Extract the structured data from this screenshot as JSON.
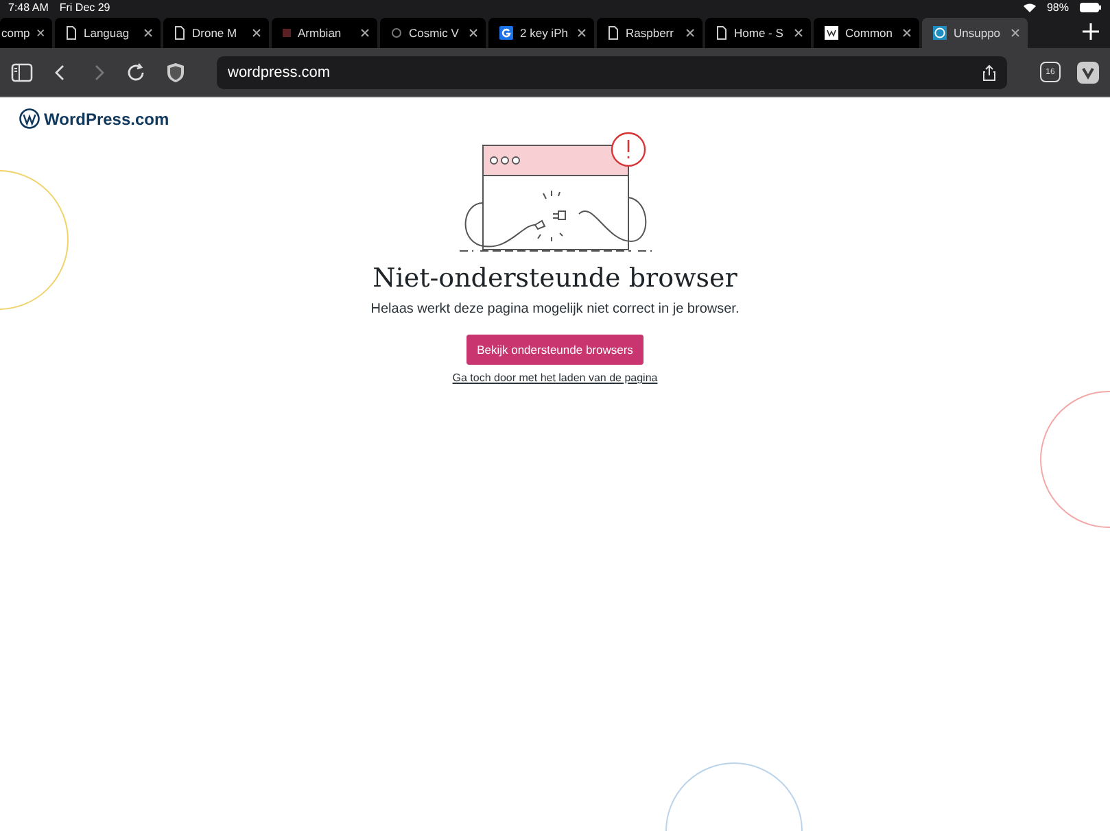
{
  "status_bar": {
    "time": "7:48 AM",
    "date": "Fri Dec 29",
    "battery": "98%"
  },
  "tabs": [
    {
      "label": "comp",
      "kind": "plain",
      "selected": false
    },
    {
      "label": "Languag",
      "kind": "doc",
      "selected": false
    },
    {
      "label": "Drone M",
      "kind": "doc",
      "selected": false
    },
    {
      "label": "Armbian",
      "kind": "square",
      "selected": false
    },
    {
      "label": "Cosmic V",
      "kind": "dot",
      "selected": false
    },
    {
      "label": "2 key iPh",
      "kind": "g",
      "selected": false
    },
    {
      "label": "Raspberr",
      "kind": "doc",
      "selected": false
    },
    {
      "label": "Home - S",
      "kind": "doc",
      "selected": false
    },
    {
      "label": "Common",
      "kind": "w",
      "selected": false
    },
    {
      "label": "Unsuppo",
      "kind": "wp",
      "selected": true
    }
  ],
  "toolbar": {
    "url": "wordpress.com",
    "tab_count": "16"
  },
  "page": {
    "logo": "WordPress.com",
    "heading": "Niet-ondersteunde browser",
    "message": "Helaas werkt deze pagina mogelijk niet correct in je browser.",
    "button": "Bekijk ondersteunde browsers",
    "link": "Ga toch door met het laden van de pagina"
  }
}
